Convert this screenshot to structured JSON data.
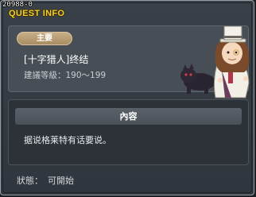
{
  "quest_id": "20988-0",
  "window": {
    "title": "QUEST INFO"
  },
  "info": {
    "category": "主要",
    "quest_name": "[十字猎人]终结",
    "level_label": "建議等級：",
    "level_range": "190〜199",
    "npc_icon": "npc-portrait-top-hat-gentleman-with-black-panther"
  },
  "content": {
    "header": "內容",
    "text": "据说格莱特有话要说。"
  },
  "status": {
    "label": "狀態：",
    "value": "可開始"
  },
  "colors": {
    "title": "#f1d13a",
    "badge": "#b89a6e",
    "panel": "#474e56",
    "content_panel": "#2d3238"
  }
}
